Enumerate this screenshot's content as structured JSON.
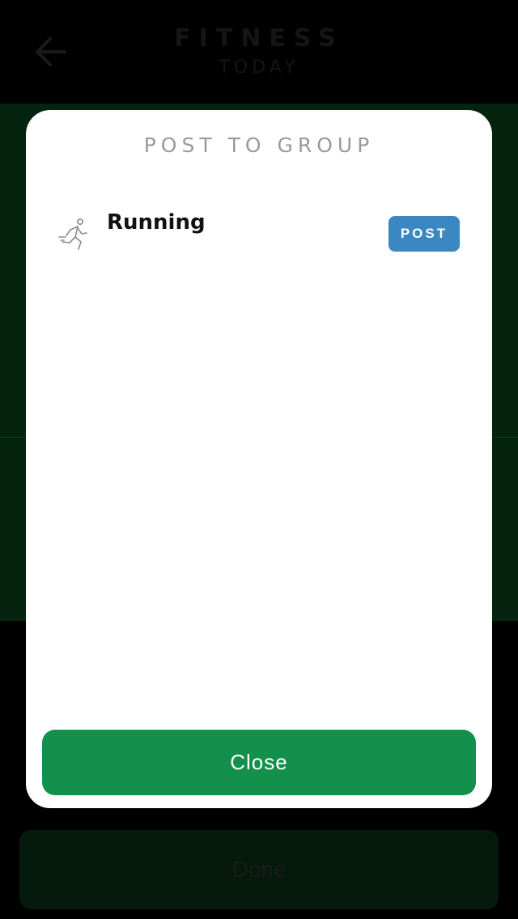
{
  "app": {
    "title": "FITNESS",
    "subtitle": "TODAY",
    "back_icon": "arrow-left-icon"
  },
  "modal": {
    "title": "POST TO GROUP",
    "groups": [
      {
        "name": "Running",
        "icon": "running-person-icon",
        "action_label": "POST"
      }
    ],
    "close_label": "Close"
  },
  "footer": {
    "done_label": "Done"
  },
  "colors": {
    "overlay_background": "#000000",
    "green_band": "#05240f",
    "modal_background": "#ffffff",
    "post_button": "#3a87c2",
    "close_button": "#13904b",
    "done_button_dimmed": "#051a0c"
  }
}
